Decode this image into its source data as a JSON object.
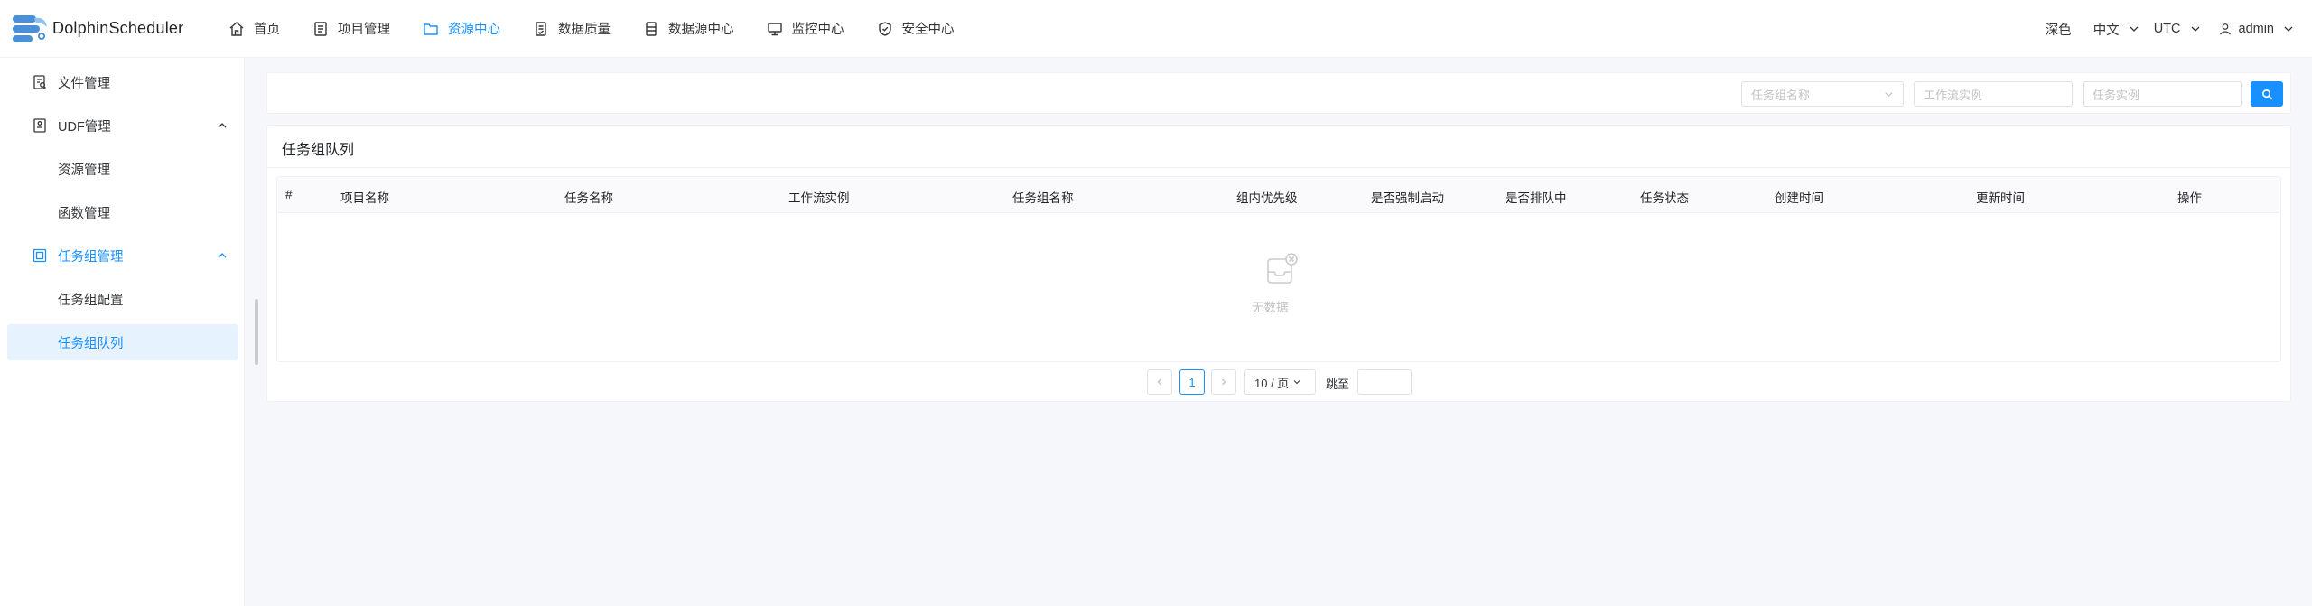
{
  "header": {
    "brand": "DolphinScheduler",
    "nav": [
      {
        "label": "首页",
        "icon": "home-icon"
      },
      {
        "label": "项目管理",
        "icon": "project-icon"
      },
      {
        "label": "资源中心",
        "icon": "folder-icon",
        "active": true
      },
      {
        "label": "数据质量",
        "icon": "data-quality-icon"
      },
      {
        "label": "数据源中心",
        "icon": "datasource-icon"
      },
      {
        "label": "监控中心",
        "icon": "monitor-icon"
      },
      {
        "label": "安全中心",
        "icon": "shield-icon"
      }
    ],
    "theme_label": "深色",
    "language": "中文",
    "timezone": "UTC",
    "user": "admin"
  },
  "sidebar": {
    "items": [
      {
        "label": "文件管理",
        "icon": "file-icon"
      },
      {
        "label": "UDF管理",
        "icon": "udf-icon",
        "expanded": true
      },
      {
        "label": "资源管理"
      },
      {
        "label": "函数管理"
      },
      {
        "label": "任务组管理",
        "icon": "task-group-icon",
        "expanded": true
      },
      {
        "label": "任务组配置"
      },
      {
        "label": "任务组队列",
        "selected": true
      }
    ]
  },
  "search": {
    "task_group_placeholder": "任务组名称",
    "workflow_instance_placeholder": "工作流实例",
    "task_instance_placeholder": "任务实例"
  },
  "list": {
    "title": "任务组队列",
    "columns": [
      "#",
      "项目名称",
      "任务名称",
      "工作流实例",
      "任务组名称",
      "组内优先级",
      "是否强制启动",
      "是否排队中",
      "任务状态",
      "创建时间",
      "更新时间",
      "操作"
    ],
    "rows": [],
    "empty_text": "无数据"
  },
  "pagination": {
    "current_page": "1",
    "page_size": "10 / 页",
    "jump_label": "跳至",
    "jump_value": ""
  },
  "colors": {
    "accent": "#1890ff",
    "selected_bg": "#e6f3ff"
  }
}
